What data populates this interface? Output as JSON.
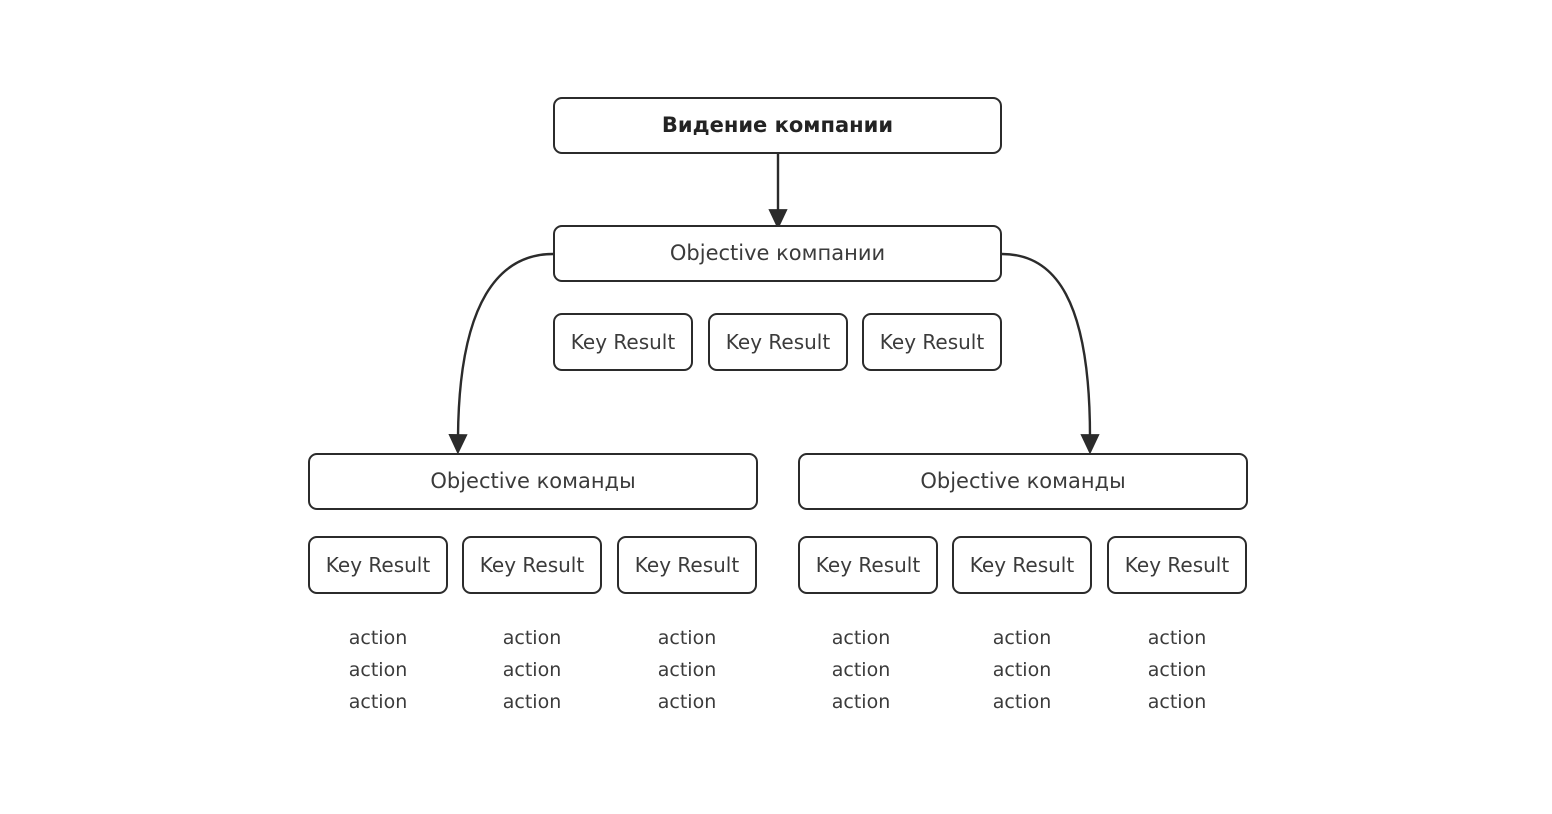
{
  "diagram": {
    "title": "OKR cascade",
    "background_color": "#ffffff",
    "stroke_color": "#2b2b2b",
    "text_color": "#3b3b3b",
    "vision": {
      "label": "Видение компании"
    },
    "company": {
      "objective": "Objective компании",
      "key_results": [
        {
          "label": "Key Result"
        },
        {
          "label": "Key Result"
        },
        {
          "label": "Key Result"
        }
      ]
    },
    "teams": [
      {
        "objective": "Objective команды",
        "key_results": [
          {
            "label": "Key Result",
            "actions": [
              "action",
              "action",
              "action"
            ]
          },
          {
            "label": "Key Result",
            "actions": [
              "action",
              "action",
              "action"
            ]
          },
          {
            "label": "Key Result",
            "actions": [
              "action",
              "action",
              "action"
            ]
          }
        ]
      },
      {
        "objective": "Objective команды",
        "key_results": [
          {
            "label": "Key Result",
            "actions": [
              "action",
              "action",
              "action"
            ]
          },
          {
            "label": "Key Result",
            "actions": [
              "action",
              "action",
              "action"
            ]
          },
          {
            "label": "Key Result",
            "actions": [
              "action",
              "action",
              "action"
            ]
          }
        ]
      }
    ],
    "connectors": [
      {
        "name": "vision-to-company-objective",
        "type": "straight-arrow"
      },
      {
        "name": "company-objective-to-team-left",
        "type": "curved-arrow"
      },
      {
        "name": "company-objective-to-team-right",
        "type": "curved-arrow"
      }
    ]
  }
}
